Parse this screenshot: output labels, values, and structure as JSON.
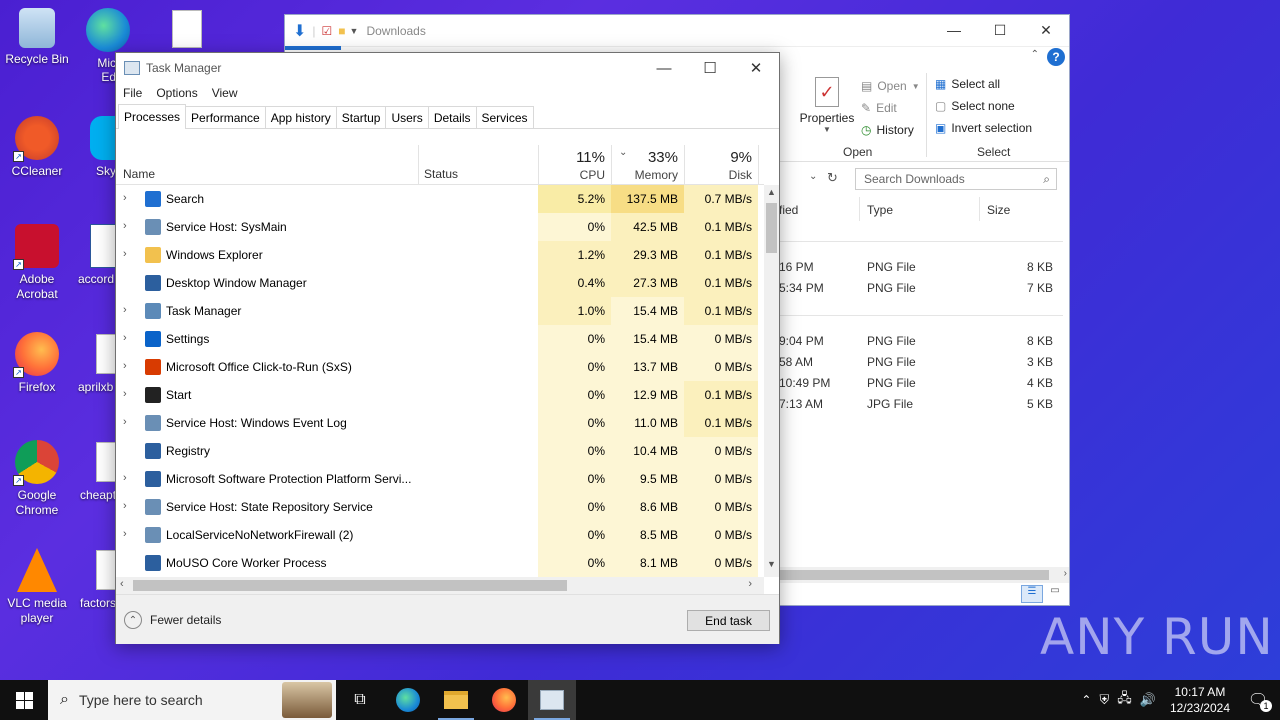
{
  "desktop": {
    "icons": [
      {
        "label": "Recycle Bin"
      },
      {
        "label": "Micro Edg"
      },
      {
        "label": "CCleaner"
      },
      {
        "label": "Sky"
      },
      {
        "label": "Adobe Acrobat"
      },
      {
        "label": "accord"
      },
      {
        "label": "Firefox"
      },
      {
        "label": "aprilxb"
      },
      {
        "label": "Google Chrome"
      },
      {
        "label": "cheapt"
      },
      {
        "label": "VLC media player"
      },
      {
        "label": "factors"
      }
    ]
  },
  "explorer": {
    "title": "Downloads",
    "ribbon": {
      "properties": "Properties",
      "open": "Open",
      "edit": "Edit",
      "history": "History",
      "open_group": "Open",
      "select_all": "Select all",
      "select_none": "Select none",
      "invert_selection": "Invert selection",
      "select_group": "Select"
    },
    "search_placeholder": "Search Downloads",
    "columns": {
      "modified": "fied",
      "type": "Type",
      "size": "Size"
    },
    "rows": [
      {
        "time": "16 PM",
        "type": "PNG File",
        "size": "8 KB"
      },
      {
        "time": "5:34 PM",
        "type": "PNG File",
        "size": "7 KB"
      },
      {
        "time": "9:04 PM",
        "type": "PNG File",
        "size": "8 KB"
      },
      {
        "time": "58 AM",
        "type": "PNG File",
        "size": "3 KB"
      },
      {
        "time": "10:49 PM",
        "type": "PNG File",
        "size": "4 KB"
      },
      {
        "time": "7:13 AM",
        "type": "JPG File",
        "size": "5 KB"
      }
    ]
  },
  "taskmgr": {
    "title": "Task Manager",
    "menu": [
      "File",
      "Options",
      "View"
    ],
    "tabs": [
      "Processes",
      "Performance",
      "App history",
      "Startup",
      "Users",
      "Details",
      "Services"
    ],
    "header": {
      "name": "Name",
      "status": "Status",
      "cpu_pct": "11%",
      "cpu": "CPU",
      "mem_pct": "33%",
      "mem": "Memory",
      "disk_pct": "9%",
      "disk": "Disk"
    },
    "processes": [
      {
        "name": "Search",
        "cpu": "5.2%",
        "mem": "137.5 MB",
        "disk": "0.7 MB/s",
        "expand": true,
        "icon_color": "#1f6fd1",
        "cpu_bg": "#f9eca6",
        "mem_bg": "#f7dd85",
        "disk_bg": "#fbf0bd"
      },
      {
        "name": "Service Host: SysMain",
        "cpu": "0%",
        "mem": "42.5 MB",
        "disk": "0.1 MB/s",
        "expand": true,
        "icon_color": "#6a8fb5",
        "cpu_bg": "#fdf6d5",
        "mem_bg": "#fbf0bd",
        "disk_bg": "#fbf0bd"
      },
      {
        "name": "Windows Explorer",
        "cpu": "1.2%",
        "mem": "29.3 MB",
        "disk": "0.1 MB/s",
        "expand": true,
        "icon_color": "#f2c14e",
        "cpu_bg": "#fbf0bd",
        "mem_bg": "#fbf0bd",
        "disk_bg": "#fbf0bd"
      },
      {
        "name": "Desktop Window Manager",
        "cpu": "0.4%",
        "mem": "27.3 MB",
        "disk": "0.1 MB/s",
        "expand": false,
        "icon_color": "#2c5f9e",
        "cpu_bg": "#fbf0bd",
        "mem_bg": "#fbf0bd",
        "disk_bg": "#fbf0bd"
      },
      {
        "name": "Task Manager",
        "cpu": "1.0%",
        "mem": "15.4 MB",
        "disk": "0.1 MB/s",
        "expand": true,
        "icon_color": "#5c8ab8",
        "cpu_bg": "#fbf0bd",
        "mem_bg": "#fdf6d5",
        "disk_bg": "#fbf0bd"
      },
      {
        "name": "Settings",
        "cpu": "0%",
        "mem": "15.4 MB",
        "disk": "0 MB/s",
        "expand": true,
        "icon_color": "#0a63c9",
        "cpu_bg": "#fdf6d5",
        "mem_bg": "#fdf6d5",
        "disk_bg": "#fdf6d5"
      },
      {
        "name": "Microsoft Office Click-to-Run (SxS)",
        "cpu": "0%",
        "mem": "13.7 MB",
        "disk": "0 MB/s",
        "expand": true,
        "icon_color": "#d83b01",
        "cpu_bg": "#fdf6d5",
        "mem_bg": "#fdf6d5",
        "disk_bg": "#fdf6d5"
      },
      {
        "name": "Start",
        "cpu": "0%",
        "mem": "12.9 MB",
        "disk": "0.1 MB/s",
        "expand": true,
        "icon_color": "#222222",
        "cpu_bg": "#fdf6d5",
        "mem_bg": "#fdf6d5",
        "disk_bg": "#fbf0bd"
      },
      {
        "name": "Service Host: Windows Event Log",
        "cpu": "0%",
        "mem": "11.0 MB",
        "disk": "0.1 MB/s",
        "expand": true,
        "icon_color": "#6a8fb5",
        "cpu_bg": "#fdf6d5",
        "mem_bg": "#fdf6d5",
        "disk_bg": "#fbf0bd"
      },
      {
        "name": "Registry",
        "cpu": "0%",
        "mem": "10.4 MB",
        "disk": "0 MB/s",
        "expand": false,
        "icon_color": "#2c5f9e",
        "cpu_bg": "#fdf6d5",
        "mem_bg": "#fdf6d5",
        "disk_bg": "#fdf6d5"
      },
      {
        "name": "Microsoft Software Protection Platform Servi...",
        "cpu": "0%",
        "mem": "9.5 MB",
        "disk": "0 MB/s",
        "expand": true,
        "icon_color": "#2c5f9e",
        "cpu_bg": "#fdf6d5",
        "mem_bg": "#fdf6d5",
        "disk_bg": "#fdf6d5"
      },
      {
        "name": "Service Host: State Repository Service",
        "cpu": "0%",
        "mem": "8.6 MB",
        "disk": "0 MB/s",
        "expand": true,
        "icon_color": "#6a8fb5",
        "cpu_bg": "#fdf6d5",
        "mem_bg": "#fdf6d5",
        "disk_bg": "#fdf6d5"
      },
      {
        "name": "LocalServiceNoNetworkFirewall (2)",
        "cpu": "0%",
        "mem": "8.5 MB",
        "disk": "0 MB/s",
        "expand": true,
        "icon_color": "#6a8fb5",
        "cpu_bg": "#fdf6d5",
        "mem_bg": "#fdf6d5",
        "disk_bg": "#fdf6d5"
      },
      {
        "name": "MoUSO Core Worker Process",
        "cpu": "0%",
        "mem": "8.1 MB",
        "disk": "0 MB/s",
        "expand": false,
        "icon_color": "#2c5f9e",
        "cpu_bg": "#fdf6d5",
        "mem_bg": "#fdf6d5",
        "disk_bg": "#fdf6d5"
      }
    ],
    "fewer_details": "Fewer details",
    "end_task": "End task"
  },
  "taskbar": {
    "search_placeholder": "Type here to search",
    "time": "10:17 AM",
    "date": "12/23/2024",
    "notifications": "1"
  },
  "watermark": "ANY RUN"
}
